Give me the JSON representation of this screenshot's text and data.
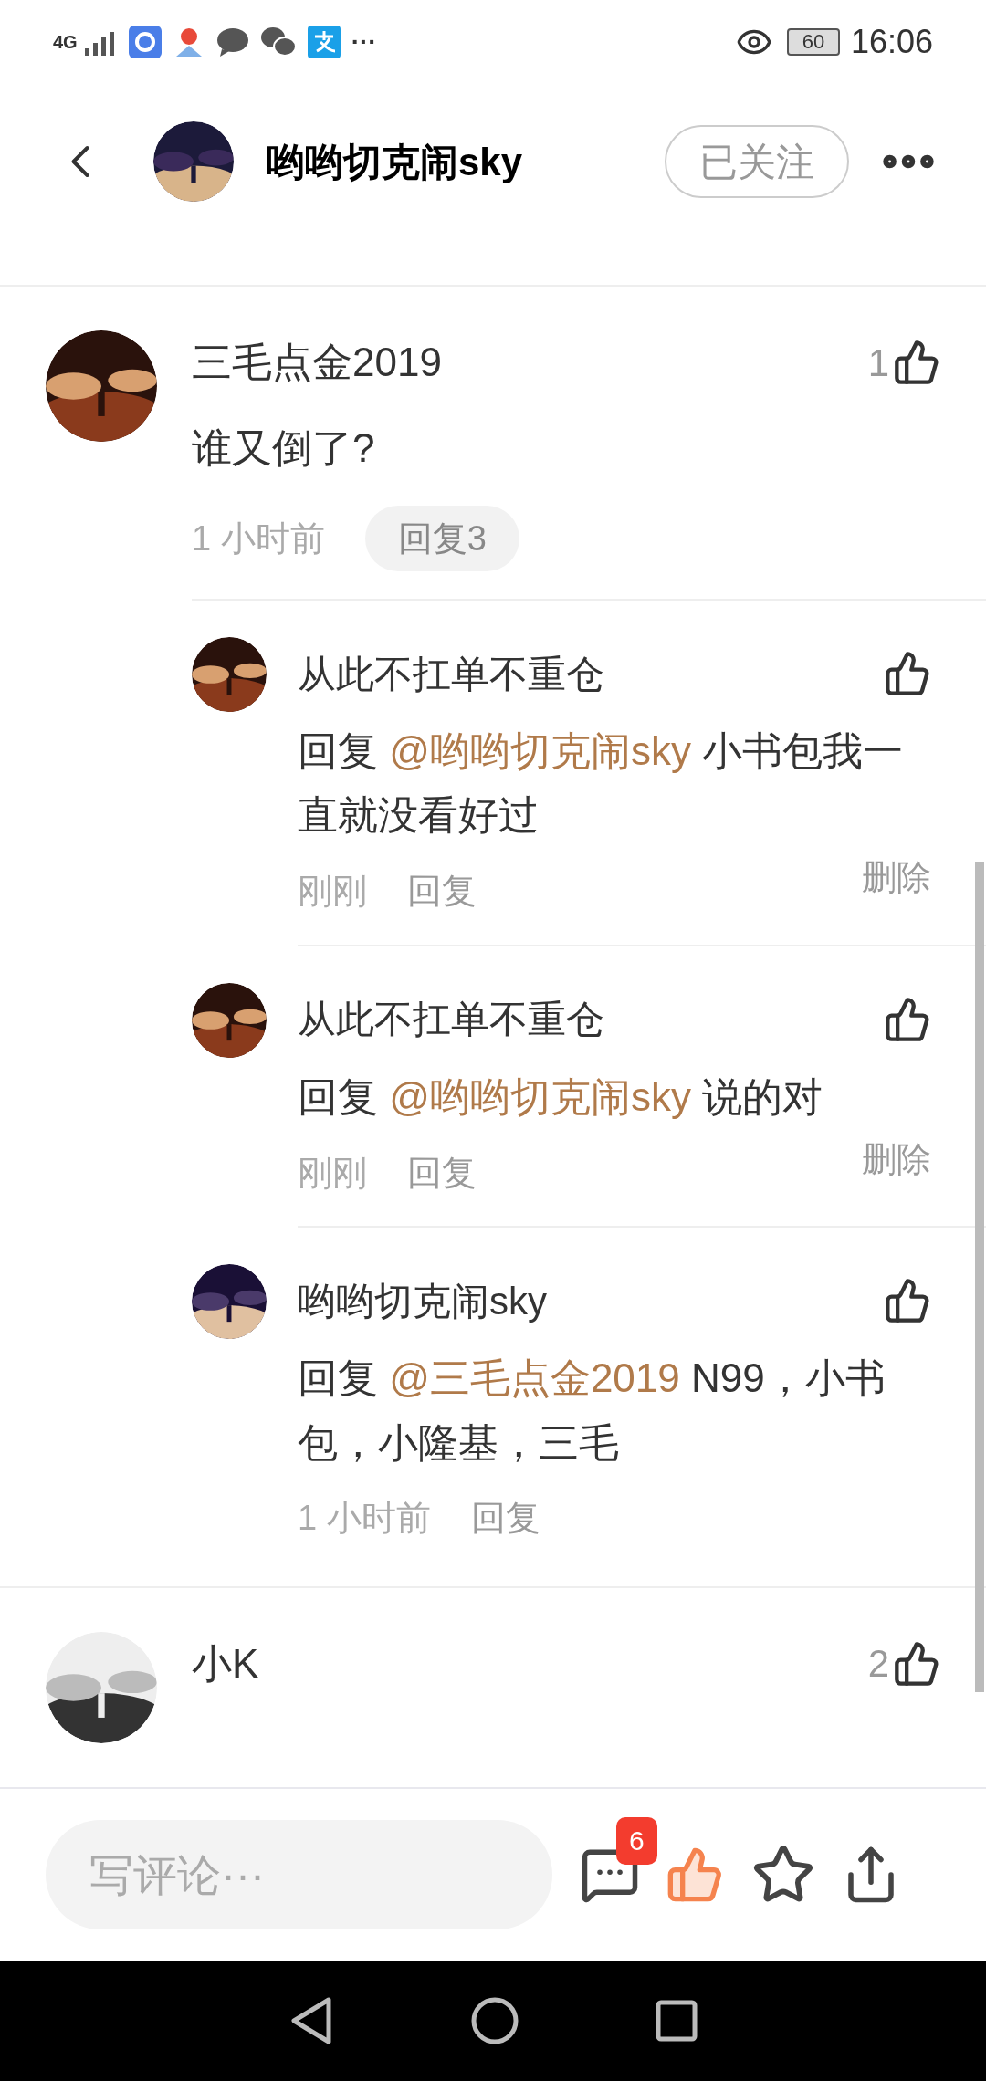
{
  "status_bar": {
    "network": "4G",
    "more": "···",
    "battery": "60",
    "time": "16:06"
  },
  "header": {
    "title": "哟哟切克闹sky",
    "follow_button": "已关注",
    "following": true
  },
  "comments": [
    {
      "author": "三毛点金2019",
      "likes": "1",
      "text": "谁又倒了?",
      "time": "1 小时前",
      "reply_button": "回复3",
      "replies": [
        {
          "author": "从此不扛单不重仓",
          "prefix": "回复",
          "mention": "@哟哟切克闹sky",
          "text": " 小书包我一直就没看好过",
          "time": "刚刚",
          "reply_button": "回复",
          "delete": "删除"
        },
        {
          "author": "从此不扛单不重仓",
          "prefix": "回复",
          "mention": "@哟哟切克闹sky",
          "text": " 说的对",
          "time": "刚刚",
          "reply_button": "回复",
          "delete": "删除"
        },
        {
          "author": "哟哟切克闹sky",
          "prefix": "回复",
          "mention": "@三毛点金2019",
          "text": " N99，小书包，小隆基，三毛",
          "time": "1 小时前",
          "reply_button": "回复"
        }
      ]
    },
    {
      "author": "小K",
      "likes": "2"
    }
  ],
  "bottom_bar": {
    "placeholder": "写评论···",
    "comment_count": "6",
    "liked": true
  }
}
